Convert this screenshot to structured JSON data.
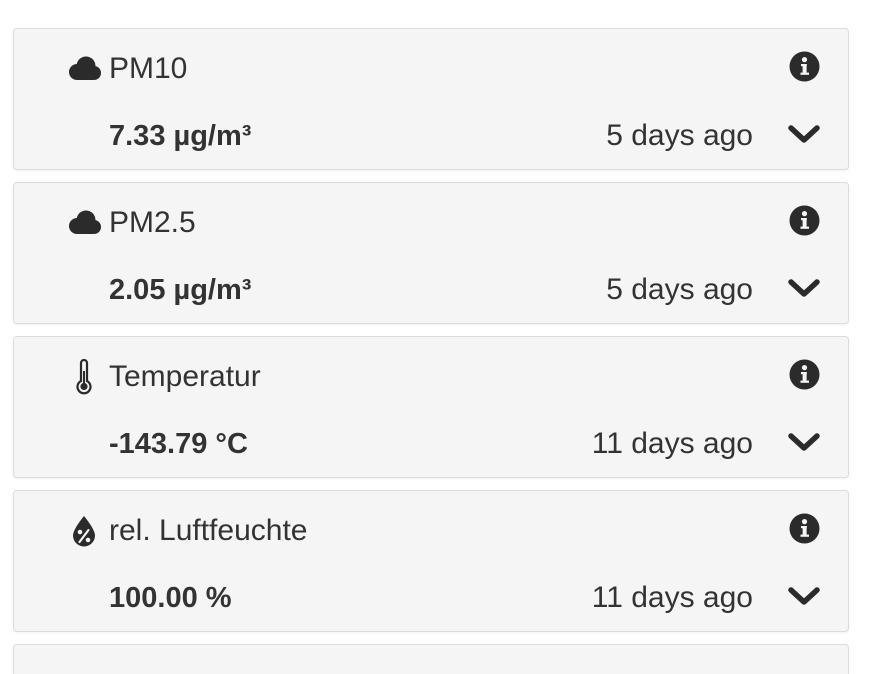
{
  "sensors": [
    {
      "icon": "cloud-icon",
      "title": "PM10",
      "value": "7.33 µg/m³",
      "time": "5 days ago"
    },
    {
      "icon": "cloud-icon",
      "title": "PM2.5",
      "value": "2.05 µg/m³",
      "time": "5 days ago"
    },
    {
      "icon": "thermometer-icon",
      "title": "Temperatur",
      "value": "-143.79 °C",
      "time": "11 days ago"
    },
    {
      "icon": "humidity-drop-icon",
      "title": "rel. Luftfeuchte",
      "value": "100.00 %",
      "time": "11 days ago"
    }
  ],
  "colors": {
    "card_background": "#f5f5f5",
    "card_border": "#dcdcdc",
    "text": "#333333",
    "icon": "#2b2b2b"
  }
}
